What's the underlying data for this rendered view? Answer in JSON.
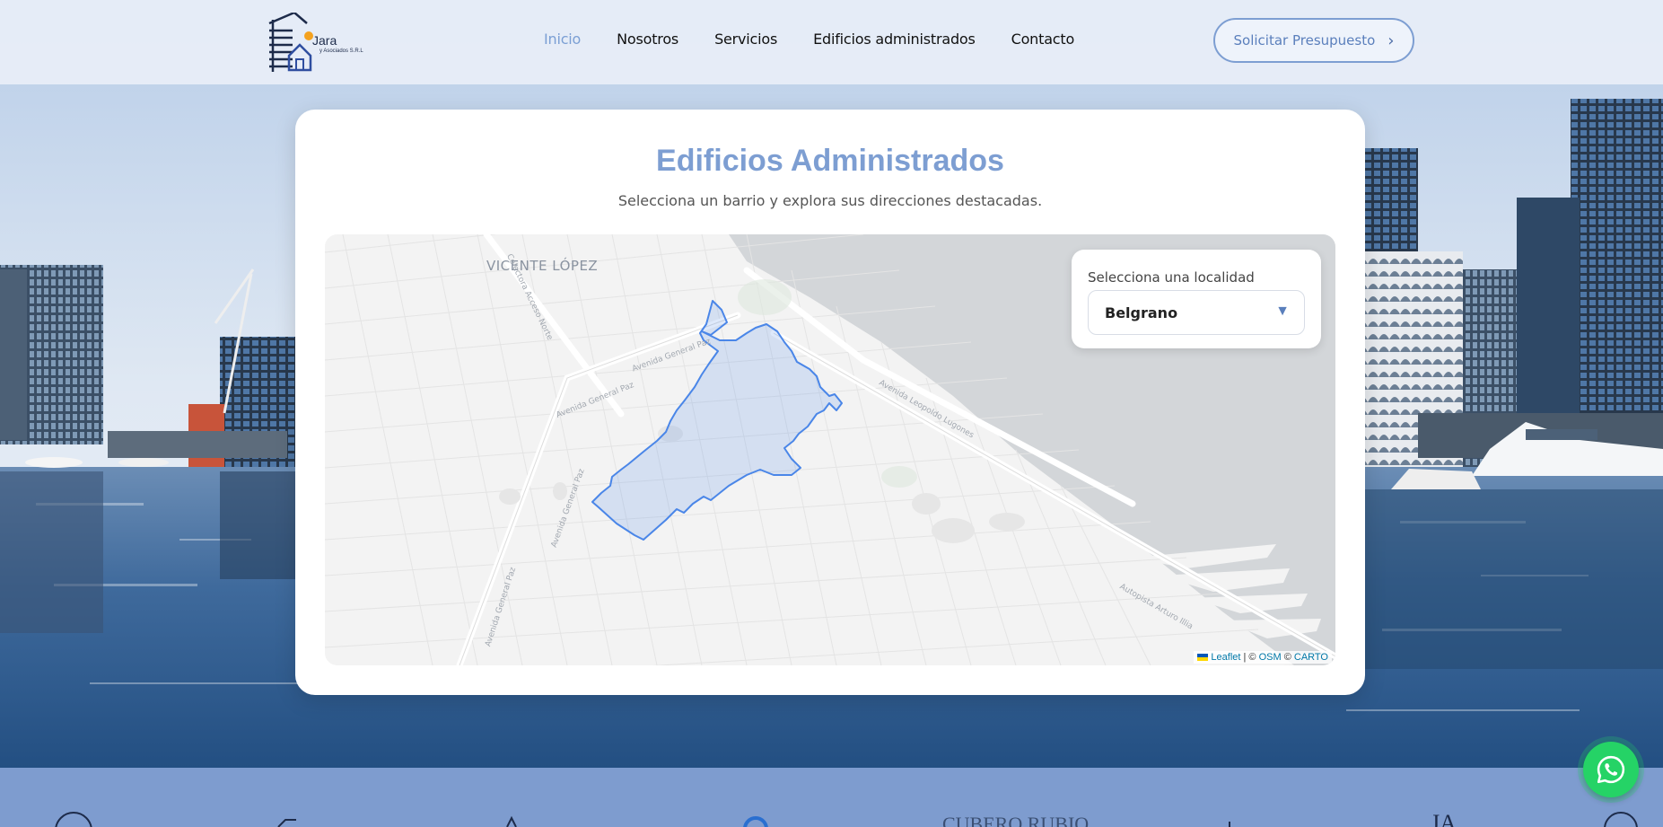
{
  "header": {
    "logo": {
      "name": "Jara",
      "sub": "y Asociados S.R.L"
    },
    "nav": [
      {
        "label": "Inicio",
        "active": true
      },
      {
        "label": "Nosotros",
        "active": false
      },
      {
        "label": "Servicios",
        "active": false
      },
      {
        "label": "Edificios administrados",
        "active": false
      },
      {
        "label": "Contacto",
        "active": false
      }
    ],
    "cta_label": "Solicitar Presupuesto"
  },
  "section": {
    "title": "Edificios Administrados",
    "subtitle": "Selecciona un barrio y explora sus direcciones destacadas."
  },
  "map": {
    "labels": {
      "city": "VICENTE LÓPEZ",
      "street_1": "Avenida General Paz",
      "street_2": "Avenida General Paz",
      "street_3": "Avenida General Paz",
      "street_4": "Colectora Acceso Norte",
      "street_5": "Avenida Leopoldo Lugones",
      "street_6": "Autopista Arturo Illia"
    },
    "selector": {
      "label": "Selecciona una localidad",
      "value": "Belgrano"
    },
    "attribution": {
      "leaflet": "Leaflet",
      "sep1": "| ©",
      "osm": "OSM",
      "sep2": "©",
      "carto": "CARTO"
    },
    "highlight_color": "#4a86e8"
  },
  "partners": {
    "logos": [
      "partner-logo-1",
      "partner-logo-2",
      "partner-logo-3",
      "partner-logo-4",
      "CUBERO RUBIO",
      "partner-logo-6",
      "JA",
      "partner-logo-8"
    ]
  },
  "colors": {
    "accent": "#7d9ed2",
    "header_bg": "#e8eef8",
    "partners_bg": "#7e9ccf",
    "whatsapp": "#25d366"
  }
}
